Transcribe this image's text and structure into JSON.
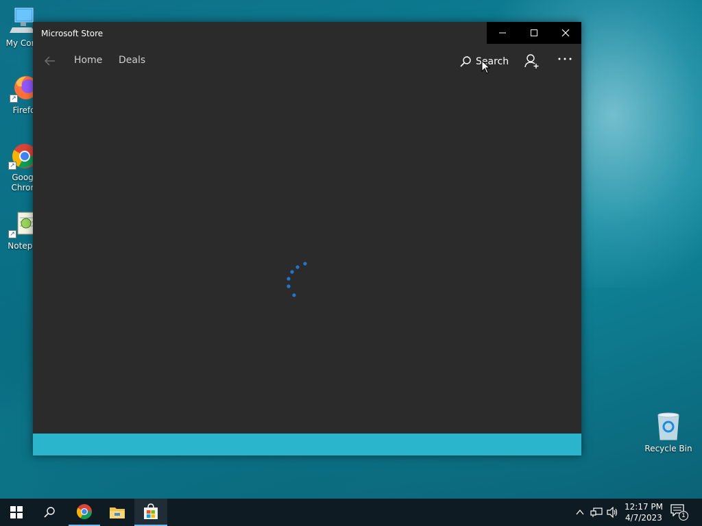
{
  "desktop": {
    "icons": [
      {
        "label": "My Com"
      },
      {
        "label": "Firefo"
      },
      {
        "label": "Goog\nChror"
      },
      {
        "label": "Notepa"
      },
      {
        "label": "Recycle Bin"
      }
    ]
  },
  "window": {
    "title": "Microsoft Store",
    "nav": {
      "home_label": "Home",
      "deals_label": "Deals",
      "search_label": "Search"
    }
  },
  "taskbar": {
    "clock_time": "12:17 PM",
    "clock_date": "4/7/2023",
    "notification_count": "1"
  },
  "colors": {
    "window_bg": "#2b2b2b",
    "accent_bar": "#2bb5cd",
    "spinner": "#1e78d2",
    "taskbar_bg": "#0f1b22"
  },
  "icons": [
    "back-arrow-icon",
    "minimize-icon",
    "maximize-icon",
    "close-icon",
    "search-icon",
    "account-icon",
    "more-icon",
    "spinner-icon",
    "windows-start-icon",
    "taskbar-search-icon",
    "chrome-icon",
    "file-explorer-icon",
    "store-icon",
    "chevron-up-icon",
    "network-icon",
    "volume-icon",
    "notification-icon",
    "recycle-bin-icon"
  ]
}
